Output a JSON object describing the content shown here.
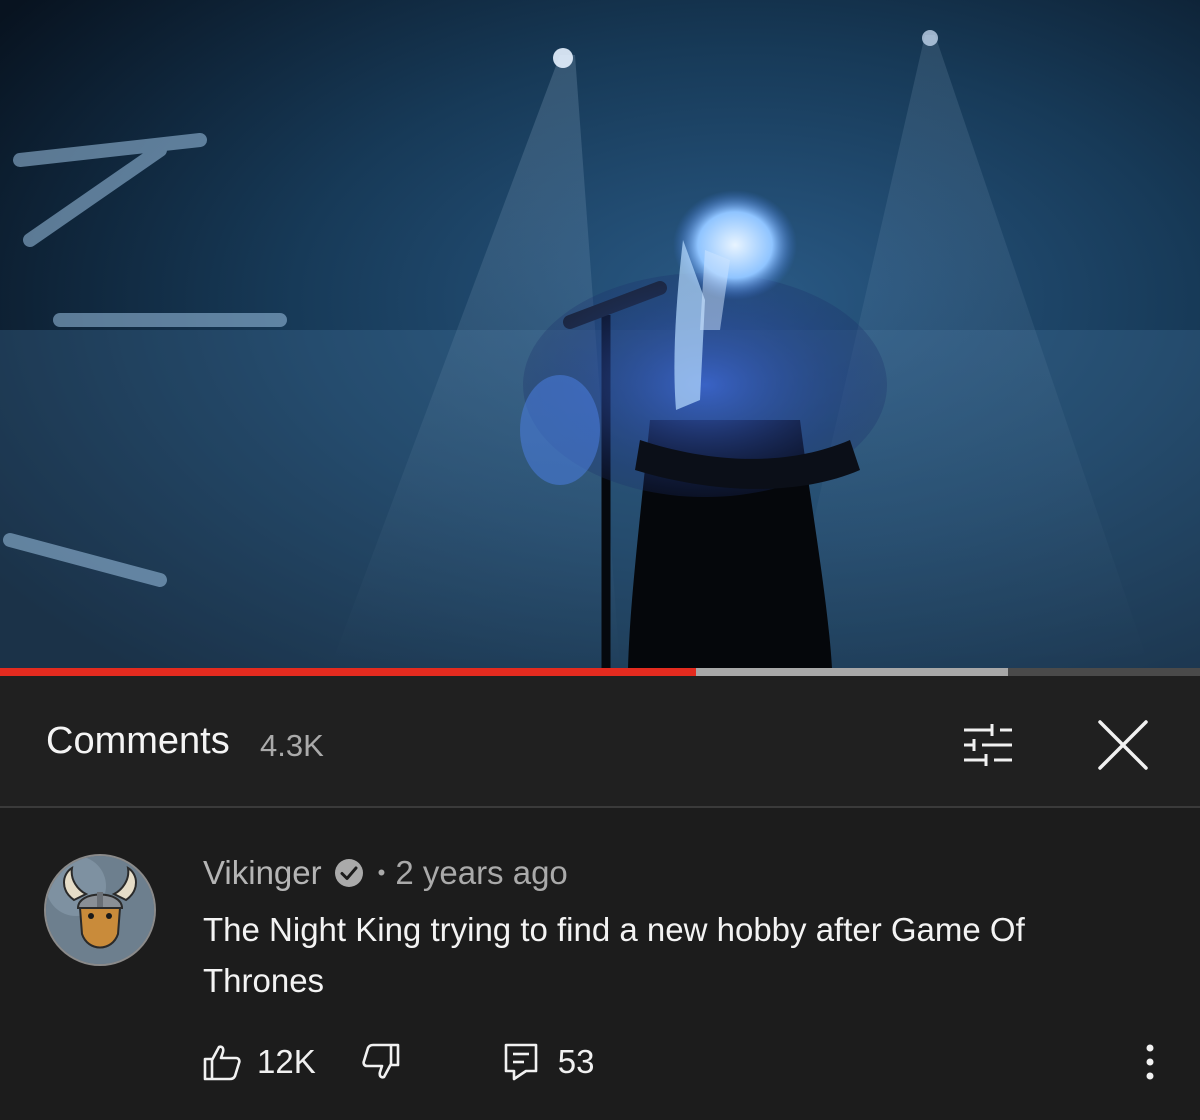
{
  "player": {
    "progress_fraction": 0.58,
    "buffered_fraction": 0.84
  },
  "comments_panel": {
    "title": "Comments",
    "count": "4.3K",
    "filter_icon": "sliders-icon",
    "close_icon": "close-icon"
  },
  "comment": {
    "author": "Vikinger",
    "verified_icon": "verified-check-icon",
    "separator": "•",
    "time": "2 years ago",
    "text": "The Night King trying to find a new hobby after Game Of Thrones",
    "likes": "12K",
    "replies": "53",
    "icons": {
      "like": "thumbs-up-icon",
      "dislike": "thumbs-down-icon",
      "reply": "reply-icon",
      "more": "more-vertical-icon"
    }
  },
  "colors": {
    "progress_played": "#e32b1f",
    "background": "#1f1f1f",
    "secondary_text": "#aaaaaa"
  }
}
